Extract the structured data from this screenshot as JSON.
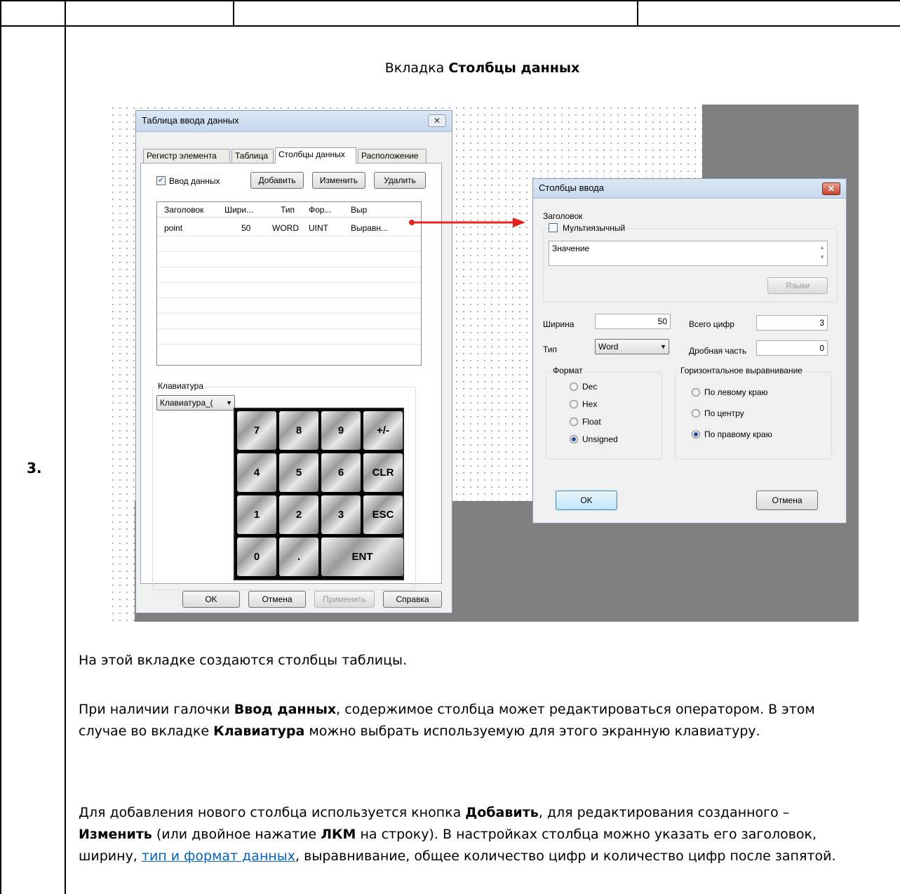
{
  "step_number": "3.",
  "caption": {
    "prefix": "Вкладка ",
    "bold": "Столбцы данных"
  },
  "main_dialog": {
    "title": "Таблица ввода данных",
    "close_glyph": "✕",
    "tabs": [
      "Регистр элемента",
      "Таблица",
      "Столбцы данных",
      "Расположение"
    ],
    "active_tab_index": 2,
    "data_entry_checkbox": {
      "label": "Ввод данных",
      "checked": true
    },
    "add_button": "Добавить",
    "edit_button": "Изменить",
    "delete_button": "Удалить",
    "grid_headers": [
      "Заголовок",
      "Шири...",
      "Тип",
      "Фор...",
      "Выр"
    ],
    "grid_rows": [
      [
        "point",
        "50",
        "WORD",
        "UINT",
        "Выравн..."
      ]
    ],
    "keyboard_group_label": "Клавиатура",
    "keyboard_select_value": "Клавиатура_(",
    "keypad_keys": [
      "7",
      "8",
      "9",
      "+/-",
      "4",
      "5",
      "6",
      "CLR",
      "1",
      "2",
      "3",
      "ESC",
      "0",
      ".",
      "ENT"
    ],
    "ok_button": "OK",
    "cancel_button": "Отмена",
    "apply_button": "Применить",
    "help_button": "Справка"
  },
  "column_dialog": {
    "title": "Столбцы ввода",
    "close_glyph": "✕",
    "header_label": "Заголовок",
    "multilang_checkbox": {
      "label": "Мультиязычный",
      "checked": false
    },
    "header_text": "Значение",
    "languages_button": "Языки",
    "width_label": "Ширина",
    "width_value": "50",
    "type_label": "Тип",
    "type_value": "Word",
    "total_digits_label": "Всего цифр",
    "total_digits_value": "3",
    "fraction_label": "Дробная часть",
    "fraction_value": "0",
    "format_group": "Формат",
    "format_options": [
      "Dec",
      "Hex",
      "Float",
      "Unsigned"
    ],
    "format_selected": 3,
    "align_group": "Горизонтальное выравнивание",
    "align_options": [
      "По левому краю",
      "По центру",
      "По правому краю"
    ],
    "align_selected": 2,
    "ok_button": "OK",
    "cancel_button": "Отмена"
  },
  "colors": {
    "arrow": "#e8231c",
    "link": "#0563c1",
    "backdrop": "#808080"
  },
  "paragraphs": {
    "p1": "На этой вкладке создаются столбцы таблицы.",
    "p2_a": "При наличии галочки ",
    "p2_b": "Ввод данных",
    "p2_c": ", содержимое столбца может редактироваться оператором. В этом случае во вкладке ",
    "p2_d": "Клавиатура",
    "p2_e": " можно выбрать используемую для этого экранную клавиатуру.",
    "p3_a": "Для добавления нового столбца используется кнопка ",
    "p3_b": "Добавить",
    "p3_c": ", для редактирования созданного – ",
    "p3_d": "Изменить",
    "p3_e": " (или двойное нажатие ",
    "p3_f": "ЛКМ",
    "p3_g": " на строку). В настройках столбца можно указать его заголовок, ширину, ",
    "p3_link": "тип и формат данных",
    "p3_h": ", выравнивание, общее количество цифр и количество цифр после запятой."
  }
}
